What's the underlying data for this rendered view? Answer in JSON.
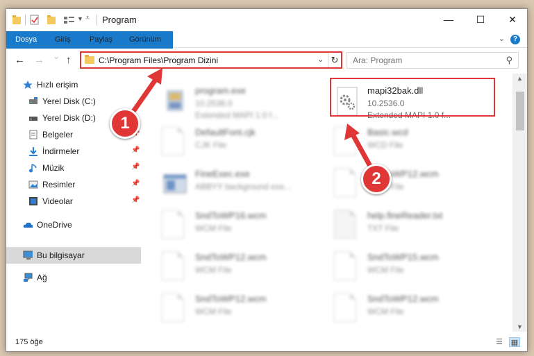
{
  "window": {
    "title": "Program",
    "controls": {
      "minimize": "—",
      "maximize": "☐",
      "close": "✕"
    }
  },
  "ribbon": {
    "tabs": [
      "Dosya",
      "Giriş",
      "Paylaş",
      "Görünüm"
    ],
    "help": "?"
  },
  "navigation": {
    "back": "←",
    "forward": "→",
    "recent": "⌄",
    "up": "↑",
    "address_path": "C:\\Program Files\\Program Dizini",
    "refresh": "↻",
    "search_placeholder": "Ara: Program"
  },
  "sidebar": {
    "items": [
      {
        "label": "Hızlı erişim",
        "icon": "star-icon"
      },
      {
        "label": "Yerel Disk (C:)",
        "icon": "drive-icon"
      },
      {
        "label": "Yerel Disk (D:)",
        "icon": "drive-icon"
      },
      {
        "label": "Belgeler",
        "icon": "documents-icon",
        "pinned": true
      },
      {
        "label": "İndirmeler",
        "icon": "download-icon",
        "pinned": true
      },
      {
        "label": "Müzik",
        "icon": "music-icon",
        "pinned": true
      },
      {
        "label": "Resimler",
        "icon": "pictures-icon",
        "pinned": true
      },
      {
        "label": "Videolar",
        "icon": "video-icon",
        "pinned": true
      },
      {
        "label": "OneDrive",
        "icon": "cloud-icon"
      },
      {
        "label": "Bu bilgisayar",
        "icon": "computer-icon",
        "selected": true
      },
      {
        "label": "Ağ",
        "icon": "network-icon"
      }
    ],
    "pin_glyph": "📌"
  },
  "files": [
    {
      "name": "program.exe",
      "line2": "10.2536.0",
      "line3": "Extended MAPI 1.0 f...",
      "icon": "exe-icon",
      "blurred": true
    },
    {
      "name": "mapi32bak.dll",
      "line2": "10.2536.0",
      "line3": "Extended MAPI 1.0 f...",
      "icon": "dll-gear-icon",
      "blurred": false,
      "highlighted": true
    },
    {
      "name": "DefaultFont.cjk",
      "line2": "CJK File",
      "line3": "",
      "icon": "generic-file-icon",
      "blurred": true
    },
    {
      "name": "Basic.wcd",
      "line2": "WCD File",
      "line3": "",
      "icon": "generic-file-icon",
      "blurred": true
    },
    {
      "name": "FineExec.exe",
      "line2": "ABBYY background exe...",
      "line3": "",
      "icon": "exe-window-icon",
      "blurred": true
    },
    {
      "name": "SndToWP12.wcm",
      "line2": "WCM File",
      "line3": "",
      "icon": "generic-file-icon",
      "blurred": true
    },
    {
      "name": "SndToWP16.wcm",
      "line2": "WCM File",
      "line3": "",
      "icon": "generic-file-icon",
      "blurred": true
    },
    {
      "name": "help.fineReader.txt",
      "line2": "TXT File",
      "line3": "",
      "icon": "text-file-icon",
      "blurred": true
    },
    {
      "name": "SndToWP12.wcm",
      "line2": "WCM File",
      "line3": "",
      "icon": "generic-file-icon",
      "blurred": true
    },
    {
      "name": "SndToWP15.wcm",
      "line2": "WCM File",
      "line3": "",
      "icon": "generic-file-icon",
      "blurred": true
    },
    {
      "name": "SndToWP12.wcm",
      "line2": "WCM File",
      "line3": "",
      "icon": "generic-file-icon",
      "blurred": true
    },
    {
      "name": "SndToWP12.wcm",
      "line2": "WCM File",
      "line3": "",
      "icon": "generic-file-icon",
      "blurred": true
    }
  ],
  "status": {
    "item_count": "175 öğe"
  },
  "annotations": {
    "step1": "1",
    "step2": "2",
    "color": "#e03636"
  }
}
